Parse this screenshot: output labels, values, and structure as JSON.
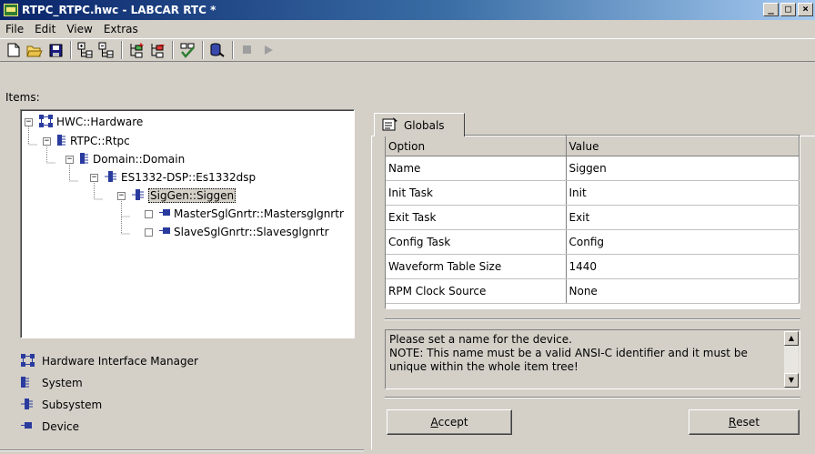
{
  "window": {
    "title": "RTPC_RTPC.hwc - LABCAR RTC  *",
    "controls": {
      "minimize": "_",
      "maximize": "□",
      "close": "×"
    }
  },
  "menu": [
    "File",
    "Edit",
    "View",
    "Extras"
  ],
  "toolbar": {
    "buttons": [
      "new-file-icon",
      "open-folder-icon",
      "save-icon",
      "expand-tree-icon",
      "collapse-tree-icon",
      "add-node-icon",
      "remove-node-icon",
      "check-icon",
      "database-icon",
      "stop-icon",
      "play-icon"
    ]
  },
  "items_label": "Items:",
  "tree": {
    "nodes": [
      {
        "label": "HWC::Hardware",
        "expander": "−",
        "icon": "hardware-icon"
      },
      {
        "label": "RTPC::Rtpc",
        "expander": "−",
        "icon": "system-icon"
      },
      {
        "label": "Domain::Domain",
        "expander": "−",
        "icon": "system-icon"
      },
      {
        "label": "ES1332-DSP::Es1332dsp",
        "expander": "−",
        "icon": "subsystem-icon"
      },
      {
        "label": "SigGen::Siggen",
        "expander": "−",
        "icon": "subsystem-icon",
        "selected": true
      },
      {
        "label": "MasterSglGnrtr::Mastersglgnrtr",
        "expander": "",
        "icon": "device-icon"
      },
      {
        "label": "SlaveSglGnrtr::Slavesglgnrtr",
        "expander": "",
        "icon": "device-icon"
      }
    ]
  },
  "legend": [
    {
      "label": "Hardware Interface Manager",
      "icon": "hardware-icon"
    },
    {
      "label": "System",
      "icon": "system-icon"
    },
    {
      "label": "Subsystem",
      "icon": "subsystem-icon"
    },
    {
      "label": "Device",
      "icon": "device-icon"
    }
  ],
  "tab": {
    "label": "Globals",
    "icon": "globals-icon"
  },
  "grid": {
    "columns": [
      "Option",
      "Value"
    ],
    "rows": [
      [
        "Name",
        "Siggen"
      ],
      [
        "Init Task",
        "Init"
      ],
      [
        "Exit Task",
        "Exit"
      ],
      [
        "Config Task",
        "Config"
      ],
      [
        "Waveform Table Size",
        "1440"
      ],
      [
        "RPM Clock Source",
        "None"
      ]
    ]
  },
  "description": {
    "lines": [
      "Please set a name for the device.",
      "NOTE: This name must be a valid ANSI-C identifier and it must be",
      "unique within the whole item tree!"
    ]
  },
  "buttons": {
    "accept": {
      "accel": "A",
      "rest": "ccept"
    },
    "reset": {
      "accel": "R",
      "rest": "eset"
    }
  },
  "colors": {
    "titlebar_start": "#0a246a",
    "titlebar_end": "#a6caf0",
    "face": "#d4d0c8",
    "icon_blue": "#2a3b9e"
  }
}
